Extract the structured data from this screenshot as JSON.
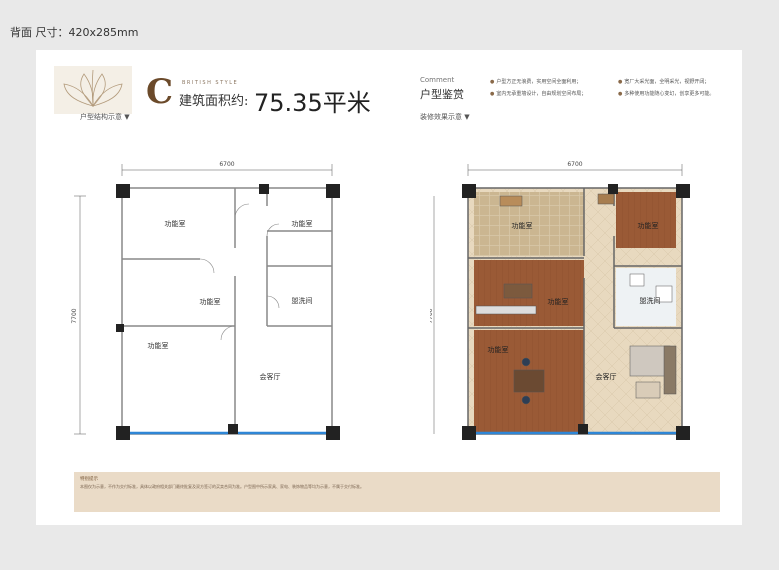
{
  "caption": "背面 尺寸：420x285mm",
  "header": {
    "type_letter": "C",
    "subtitle_en": "BRITISH STYLE",
    "area_label": "建筑面积约:",
    "area_value": "75.35平米"
  },
  "left_plan": {
    "title": "户型结构示意 ▼",
    "width_dim": "6700",
    "height_dim": "7700",
    "rooms": [
      "功能室",
      "功能室",
      "功能室",
      "盥洗间",
      "功能室",
      "会客厅"
    ]
  },
  "right_section": {
    "comment_en": "Comment",
    "comment_cn": "户型鉴赏",
    "features_col1": [
      "户型方正无浪费，实用空间全面利用；",
      "室内无承重墙设计，自由规划空间布局；"
    ],
    "features_col2": [
      "宽厂大采光面，全明采光，视野开阔；",
      "多种使用功能随心变幻，创享更多可能。"
    ]
  },
  "right_plan": {
    "title": "装修效果示意 ▼",
    "width_dim": "6700",
    "height_dim": "7700",
    "rooms": [
      "功能室",
      "功能室",
      "功能室",
      "盥洗间",
      "功能室",
      "会客厅"
    ]
  },
  "note": {
    "title": "特别提示",
    "text": "本图仅为示意，不作为交付标准，具体以政府相关部门最终批复及双方签订的买卖合同为准。户型图中所示家具、家电、装饰物品等均为示意，不属于交付标准。"
  },
  "colors": {
    "wall": "#222222",
    "window": "#2e86d6",
    "accent": "#6b4a2a",
    "note_band": "#eadbc7",
    "wood_floor": "#9a5a36",
    "tile_floor": "#e8d9bf"
  }
}
